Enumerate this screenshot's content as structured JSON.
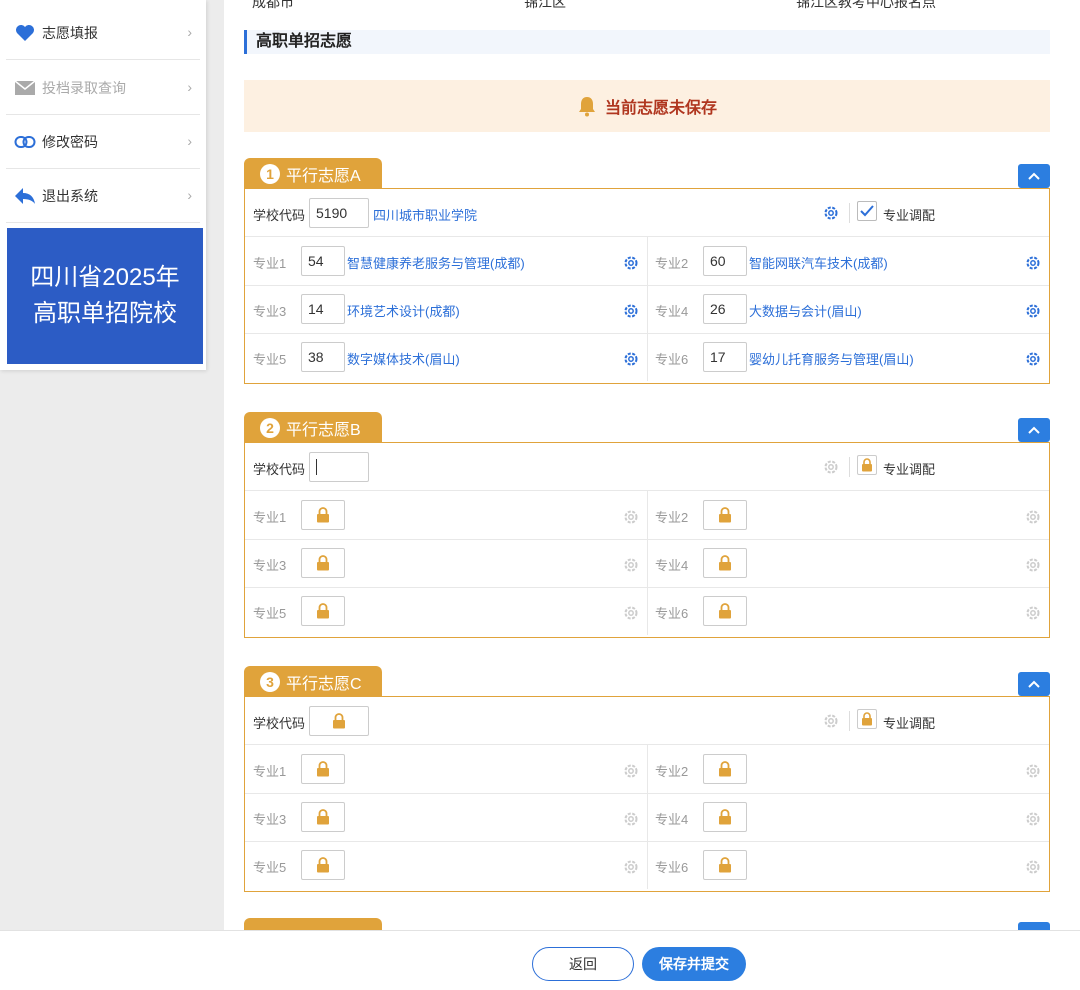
{
  "sidebar": {
    "items": [
      {
        "label": "志愿填报"
      },
      {
        "label": "投档录取查询"
      },
      {
        "label": "修改密码"
      },
      {
        "label": "退出系统"
      }
    ],
    "banner_line1": "四川省2025年",
    "banner_line2": "高职单招院校"
  },
  "top_row": {
    "city": "成都市",
    "district": "锦江区",
    "site": "锦江区教考中心报名点"
  },
  "section_title": "高职单招志愿",
  "notice": "当前志愿未保存",
  "volunteers": [
    {
      "num": "1",
      "title": "平行志愿A",
      "school_label": "学校代码",
      "school_code": "5190",
      "school_name": "四川城市职业学院",
      "adjust_label": "专业调配",
      "majors": [
        {
          "label": "专业1",
          "code": "54",
          "name": "智慧健康养老服务与管理(成都)"
        },
        {
          "label": "专业2",
          "code": "60",
          "name": "智能网联汽车技术(成都)"
        },
        {
          "label": "专业3",
          "code": "14",
          "name": "环境艺术设计(成都)"
        },
        {
          "label": "专业4",
          "code": "26",
          "name": "大数据与会计(眉山)"
        },
        {
          "label": "专业5",
          "code": "38",
          "name": "数字媒体技术(眉山)"
        },
        {
          "label": "专业6",
          "code": "17",
          "name": "婴幼儿托育服务与管理(眉山)"
        }
      ]
    },
    {
      "num": "2",
      "title": "平行志愿B",
      "school_label": "学校代码",
      "adjust_label": "专业调配",
      "majors": [
        {
          "label": "专业1"
        },
        {
          "label": "专业2"
        },
        {
          "label": "专业3"
        },
        {
          "label": "专业4"
        },
        {
          "label": "专业5"
        },
        {
          "label": "专业6"
        }
      ]
    },
    {
      "num": "3",
      "title": "平行志愿C",
      "school_label": "学校代码",
      "adjust_label": "专业调配",
      "majors": [
        {
          "label": "专业1"
        },
        {
          "label": "专业2"
        },
        {
          "label": "专业3"
        },
        {
          "label": "专业4"
        },
        {
          "label": "专业5"
        },
        {
          "label": "专业6"
        }
      ]
    }
  ],
  "footer": {
    "back_label": "返回",
    "submit_label": "保存并提交"
  },
  "colors": {
    "accent": "#2c7ee0",
    "tab": "#e0a33b",
    "notice_bg": "#fdf0e1",
    "notice_text": "#b0361f"
  }
}
